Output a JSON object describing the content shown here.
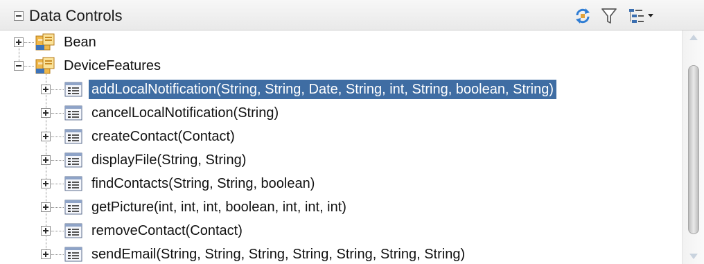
{
  "panel": {
    "title": "Data Controls",
    "toolbar": {
      "refresh_icon": "refresh-icon",
      "filter_icon": "filter-icon",
      "tree_options_icon": "tree-options-icon"
    }
  },
  "tree": {
    "roots": [
      {
        "label": "Bean",
        "icon": "data-control-icon",
        "expanded": false
      },
      {
        "label": "DeviceFeatures",
        "icon": "data-control-icon",
        "expanded": true
      }
    ],
    "methods": [
      {
        "label": "addLocalNotification(String, String, Date, String, int, String, boolean, String)",
        "selected": true
      },
      {
        "label": "cancelLocalNotification(String)"
      },
      {
        "label": "createContact(Contact)"
      },
      {
        "label": "displayFile(String, String)"
      },
      {
        "label": "findContacts(String, String, boolean)"
      },
      {
        "label": "getPicture(int, int, int, boolean, int, int, int)"
      },
      {
        "label": "removeContact(Contact)"
      },
      {
        "label": "sendEmail(String, String, String, String, String, String, String)"
      }
    ]
  },
  "colors": {
    "selection": "#3f6da3",
    "selection_text": "#ffffff",
    "refresh_icon": "#2f7dd4"
  }
}
